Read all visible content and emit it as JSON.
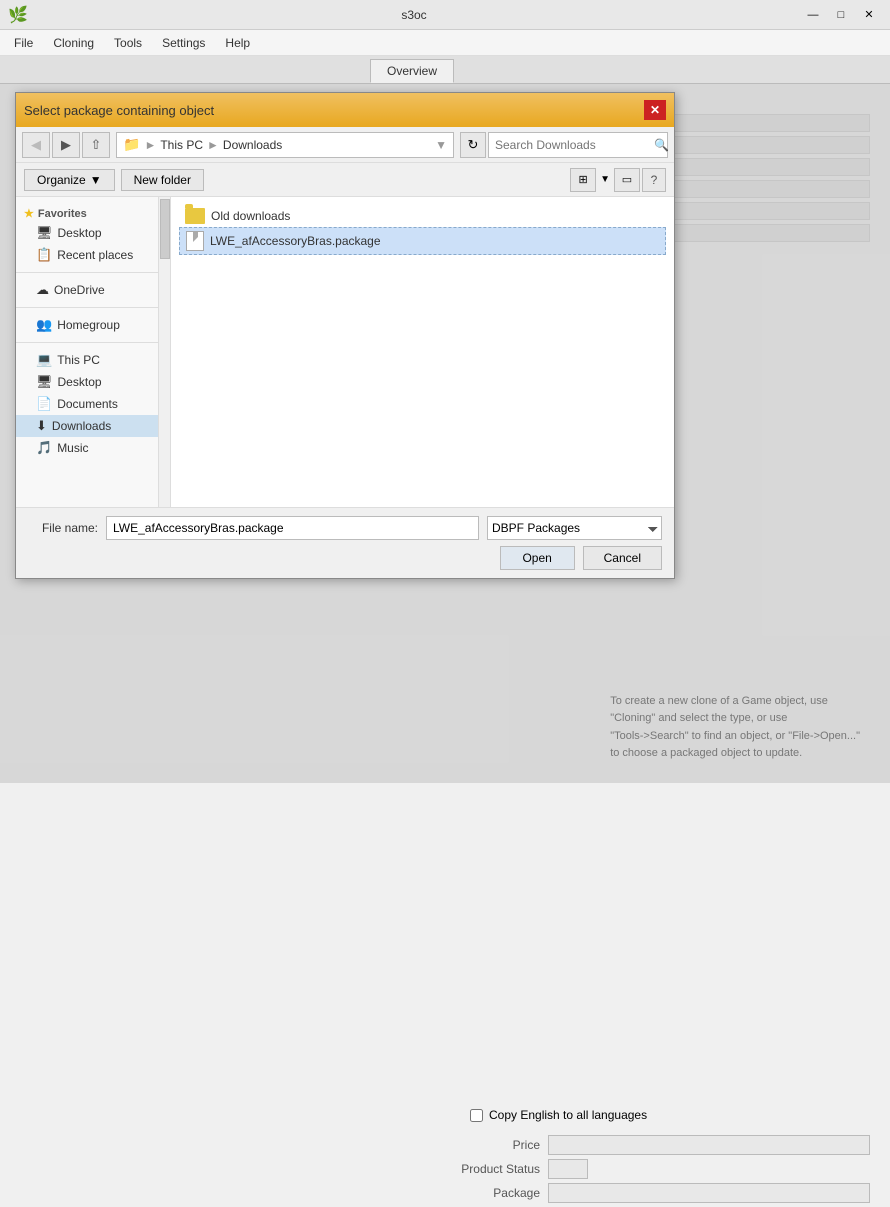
{
  "app": {
    "title": "s3oc",
    "icon": "🌿"
  },
  "titlebar": {
    "minimize_label": "—",
    "maximize_label": "□",
    "close_label": "✕"
  },
  "menubar": {
    "items": [
      {
        "label": "File"
      },
      {
        "label": "Cloning"
      },
      {
        "label": "Tools"
      },
      {
        "label": "Settings"
      },
      {
        "label": "Help"
      }
    ]
  },
  "tabs": [
    {
      "label": "Overview",
      "active": true
    }
  ],
  "dialog": {
    "title": "Select package containing object",
    "close_label": "✕",
    "nav": {
      "back_label": "◀",
      "forward_label": "▶",
      "up_label": "↑",
      "path_items": [
        "This PC",
        "Downloads"
      ],
      "refresh_label": "↻"
    },
    "search_placeholder": "Search Downloads",
    "actions": {
      "organize_label": "Organize",
      "new_folder_label": "New folder",
      "view_label": "⊞",
      "panel_label": "▭",
      "help_label": "?"
    },
    "sidebar": {
      "favorites_label": "Favorites",
      "desktop_label": "Desktop",
      "recent_places_label": "Recent places",
      "onedrive_label": "OneDrive",
      "homegroup_label": "Homegroup",
      "this_pc_label": "This PC",
      "desktop2_label": "Desktop",
      "documents_label": "Documents",
      "downloads_label": "Downloads",
      "music_label": "Music"
    },
    "files": [
      {
        "name": "Old downloads",
        "type": "folder",
        "selected": false
      },
      {
        "name": "LWE_afAccessoryBras.package",
        "type": "file",
        "selected": true
      }
    ],
    "footer": {
      "filename_label": "File name:",
      "filename_value": "LWE_afAccessoryBras.package",
      "filetype_label": "DBPF Packages",
      "open_label": "Open",
      "cancel_label": "Cancel"
    }
  },
  "below": {
    "checkbox_label": "Copy English to all languages",
    "price_label": "Price",
    "product_status_label": "Product Status",
    "package_label": "Package",
    "info_text": "To create a new clone of a Game object, use\n\"Cloning\" and select the type, or use\n\"Tools->Search\" to find an object, or \"File->Open...\"\nto choose a packaged object to update."
  },
  "colors": {
    "dialog_title_bg_start": "#f0c060",
    "dialog_title_bg_end": "#e8a820",
    "selected_file_bg": "#cce0f8"
  }
}
